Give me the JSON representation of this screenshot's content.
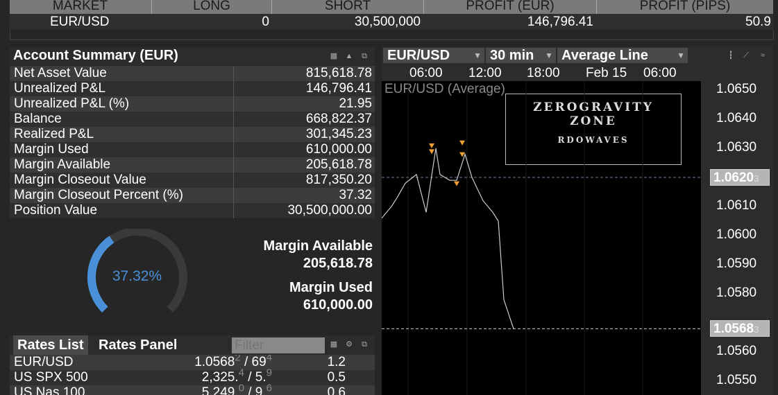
{
  "positions": {
    "headers": [
      "MARKET",
      "LONG",
      "SHORT",
      "PROFIT (EUR)",
      "PROFIT (PIPS)"
    ],
    "row": {
      "market": "EUR/USD",
      "long": "0",
      "short": "30,500,000",
      "profit_eur": "146,796.41",
      "profit_pips": "50.9"
    }
  },
  "account_summary": {
    "title": "Account Summary (EUR)",
    "rows": [
      {
        "label": "Net Asset Value",
        "value": "815,618.78"
      },
      {
        "label": "Unrealized P&L",
        "value": "146,796.41"
      },
      {
        "label": "Unrealized P&L (%)",
        "value": "21.95"
      },
      {
        "label": "Balance",
        "value": "668,822.37"
      },
      {
        "label": "Realized P&L",
        "value": "301,345.23"
      },
      {
        "label": "Margin Used",
        "value": "610,000.00"
      },
      {
        "label": "Margin Available",
        "value": "205,618.78"
      },
      {
        "label": "Margin Closeout Value",
        "value": "817,350.20"
      },
      {
        "label": "Margin Closeout Percent (%)",
        "value": "37.32"
      },
      {
        "label": "Position Value",
        "value": "30,500,000.00"
      }
    ]
  },
  "gauge": {
    "percent_text": "37.32%",
    "fraction": 0.3732,
    "color": "#4a90d9"
  },
  "margin": {
    "available_label": "Margin Available",
    "available_value": "205,618.78",
    "used_label": "Margin Used",
    "used_value": "610,000.00"
  },
  "rates": {
    "tabs": [
      "Rates List",
      "Rates Panel"
    ],
    "filter_placeholder": "Filter",
    "rows": [
      {
        "symbol": "EUR/USD",
        "bid_main": "1.0568",
        "bid_pip": "2",
        "ask_main": "69",
        "ask_pip": "4",
        "spread": "1.2"
      },
      {
        "symbol": "US SPX 500",
        "bid_main": "2,325.",
        "bid_pip": "4",
        "ask_main": "5.",
        "ask_pip": "9",
        "spread": "0.5"
      },
      {
        "symbol": "US Nas 100",
        "bid_main": "5,249.",
        "bid_pip": "0",
        "ask_main": "9.",
        "ask_pip": "6",
        "spread": "0.6"
      }
    ]
  },
  "chart": {
    "instrument": "EUR/USD",
    "granularity": "30 min",
    "style": "Average Line",
    "series_label": "EUR/USD (Average)",
    "time_labels": [
      "06:00",
      "12:00",
      "18:00",
      "Feb 15",
      "06:00"
    ],
    "price_labels": [
      "1.0650",
      "1.0640",
      "1.0630",
      "1.0610",
      "1.0600",
      "1.0590",
      "1.0580",
      "1.0560",
      "1.0550"
    ],
    "current_high": {
      "main": "1.0620",
      "pip": "3"
    },
    "current_low": {
      "main": "1.0568",
      "pip": "3"
    },
    "watermark": [
      "ZEROGRAVITY",
      "ZONE",
      "RDOWAVES"
    ],
    "line_color": "#cccccc",
    "marker_color": "#f0a030"
  },
  "chart_data": {
    "type": "line",
    "series": [
      {
        "name": "EUR/USD (Average)",
        "values": [
          1.0606,
          1.061,
          1.0613,
          1.0618,
          1.0621,
          1.0608,
          1.063,
          1.0621,
          1.0619,
          1.0619,
          1.0628,
          1.062,
          1.0612,
          1.0608,
          1.0605,
          1.0578,
          1.0568
        ]
      }
    ],
    "ylim": [
      1.0545,
      1.0655
    ]
  }
}
